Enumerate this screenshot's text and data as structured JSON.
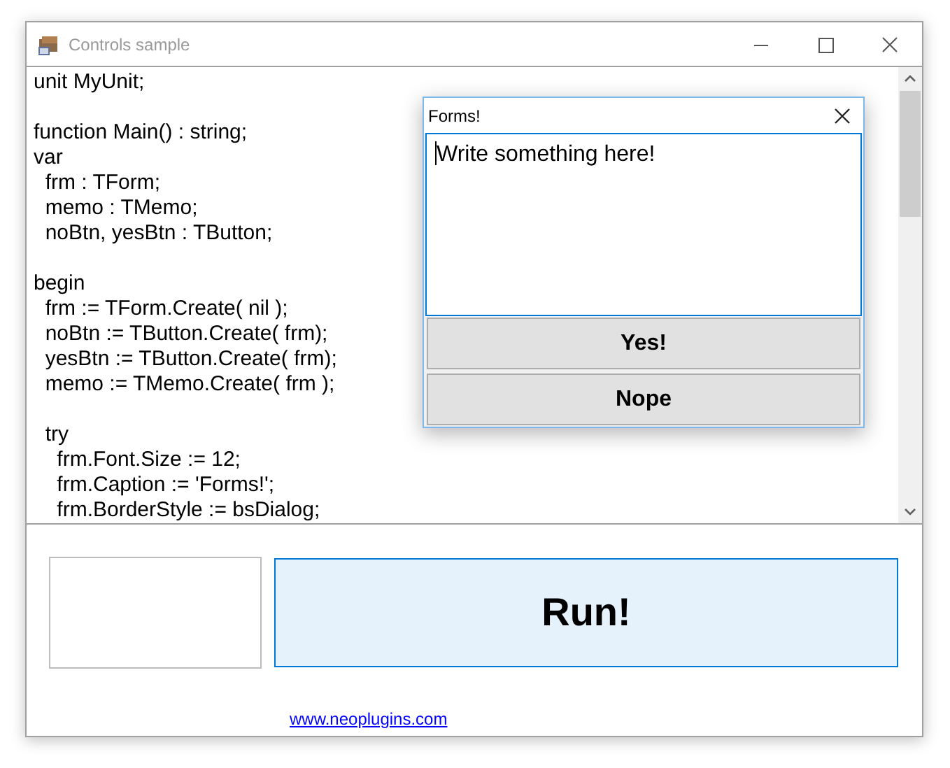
{
  "window": {
    "title": "Controls sample"
  },
  "editor": {
    "paragraphs": [
      [
        "unit MyUnit;"
      ],
      [
        "function Main() : string;",
        "var",
        "  frm : TForm;",
        "  memo : TMemo;",
        "  noBtn, yesBtn : TButton;"
      ],
      [
        "begin",
        "  frm := TForm.Create( nil );",
        "  noBtn := TButton.Create( frm);",
        "  yesBtn := TButton.Create( frm);",
        "  memo := TMemo.Create( frm );"
      ],
      [
        "  try",
        "    frm.Font.Size := 12;",
        "    frm.Caption := 'Forms!';",
        "    frm.BorderStyle := bsDialog;"
      ]
    ]
  },
  "dialog": {
    "title": "Forms!",
    "memo": {
      "value": "Write something here!"
    },
    "buttons": [
      "Yes!",
      "Nope"
    ]
  },
  "run_button": {
    "label": "Run!"
  },
  "link": "www.neoplugins.com"
}
